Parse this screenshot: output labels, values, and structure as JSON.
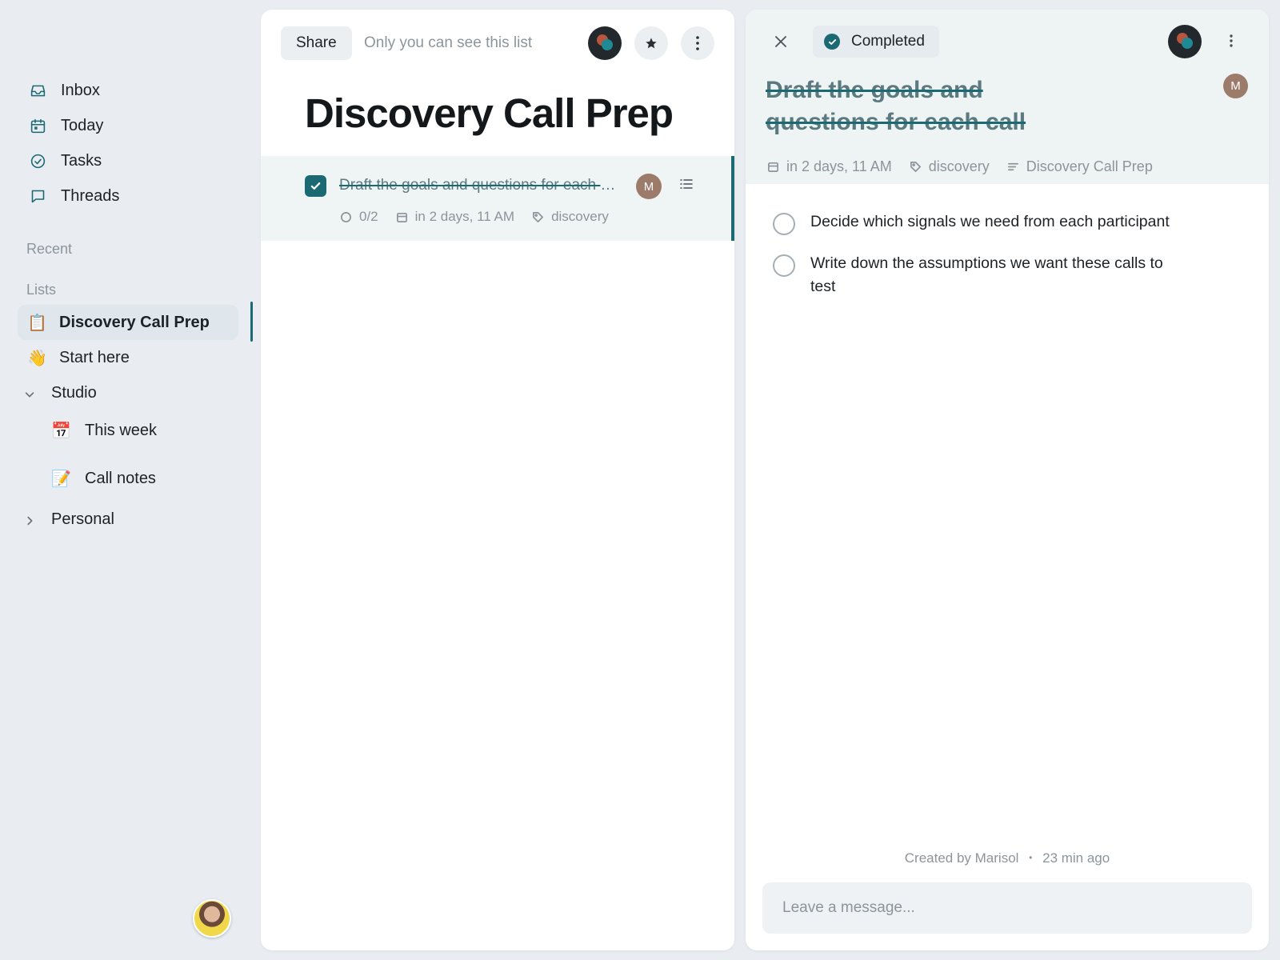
{
  "nav": [
    {
      "label": "Inbox",
      "icon": "inbox-icon"
    },
    {
      "label": "Today",
      "icon": "calendar-today-icon"
    },
    {
      "label": "Tasks",
      "icon": "check-circle-icon"
    },
    {
      "label": "Threads",
      "icon": "chat-bubble-icon"
    }
  ],
  "sections": {
    "recent": "Recent",
    "lists": "Lists"
  },
  "lists": {
    "active": {
      "emoji": "📋",
      "label": "Discovery Call Prep"
    },
    "start": {
      "emoji": "👋",
      "label": "Start here"
    },
    "studio": {
      "label": "Studio",
      "children": [
        {
          "emoji": "📅",
          "label": "This week"
        },
        {
          "emoji": "📝",
          "label": "Call notes"
        }
      ]
    },
    "personal": {
      "label": "Personal"
    }
  },
  "list_view": {
    "share_label": "Share",
    "visibility": "Only you can see this list",
    "title": "Discovery Call Prep",
    "task": {
      "title": "Draft the goals and questions for each call",
      "assignee_initial": "M",
      "subtask_count": "0/2",
      "due": "in 2 days, 11 AM",
      "tag": "discovery"
    }
  },
  "detail": {
    "status": "Completed",
    "title": "Draft the goals and questions for each call",
    "assignee_initial": "M",
    "due": "in 2 days, 11 AM",
    "tag": "discovery",
    "list": "Discovery Call Prep",
    "subtasks": [
      {
        "text": "Decide which signals we need from each participant"
      },
      {
        "text": "Write down the assumptions we want these calls to test"
      }
    ],
    "created_by": "Created by Marisol",
    "created_sep": "•",
    "created_time": "23 min ago",
    "message_placeholder": "Leave a message..."
  },
  "colors": {
    "accent": "#1b6973",
    "background": "#e9edf1",
    "muted": "#8c959c"
  }
}
